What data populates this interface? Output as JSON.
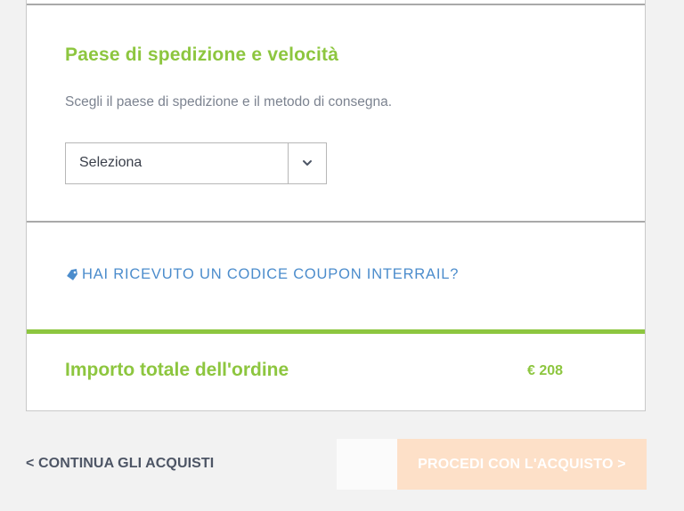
{
  "shipping": {
    "title": "Paese di spedizione e velocità",
    "description": "Scegli il paese di spedizione e il metodo di consegna.",
    "select": {
      "selected": "Seleziona",
      "icon": "chevron-down-icon"
    }
  },
  "coupon": {
    "icon": "tag-icon",
    "label": "HAI RICEVUTO UN CODICE COUPON INTERRAIL?",
    "color": "#4b8ccc"
  },
  "total": {
    "label": "Importo totale dell'ordine",
    "amount": "€ 208"
  },
  "footer": {
    "continue_label": "< CONTINUA GLI ACQUISTI",
    "proceed_label": "PROCEDI CON L'ACQUISTO >"
  },
  "colors": {
    "accent_green": "#8dc63f",
    "proceed_button_bg": "#fde0c8",
    "text_dark": "#4d5565"
  }
}
